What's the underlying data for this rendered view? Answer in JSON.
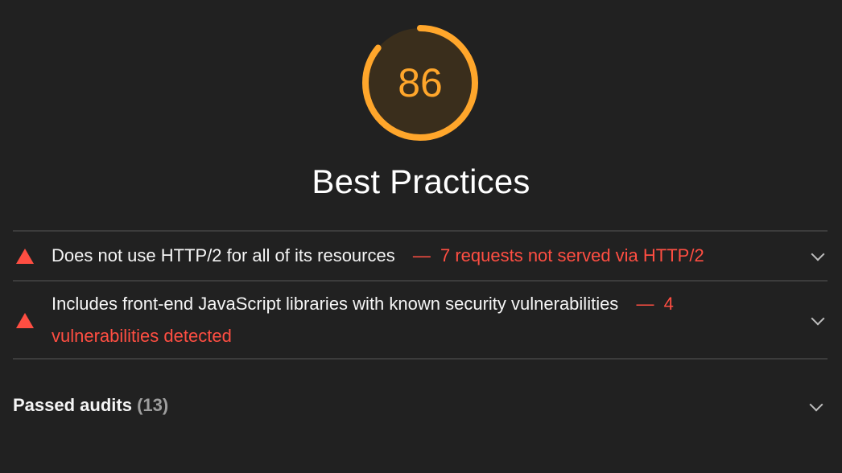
{
  "gauge": {
    "score": "86",
    "score_fraction": 0.86,
    "color": "#ffa62b"
  },
  "category": {
    "title": "Best Practices"
  },
  "audits": [
    {
      "title": "Does not use HTTP/2 for all of its resources",
      "separator": "—",
      "display_value": "7 requests not served via HTTP/2",
      "status_icon": "fail-triangle-icon",
      "expand_icon": "chevron-down-icon"
    },
    {
      "title": "Includes front-end JavaScript libraries with known security vulnerabilities",
      "separator": "—",
      "display_value_part1": "4",
      "display_value_part2": "vulnerabilities detected",
      "status_icon": "fail-triangle-icon",
      "expand_icon": "chevron-down-icon"
    }
  ],
  "passed_audits": {
    "label": "Passed audits",
    "count": "(13)",
    "expand_icon": "chevron-down-icon"
  },
  "colors": {
    "background": "#212121",
    "fail": "#ff4e42",
    "average": "#ffa62b"
  }
}
